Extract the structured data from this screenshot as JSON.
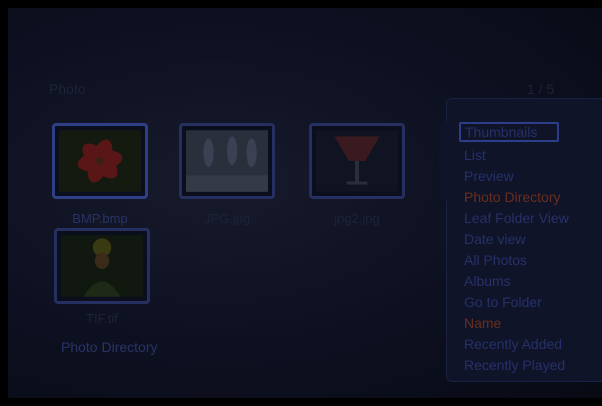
{
  "header": {
    "title": "Photo",
    "page": "1 / 5"
  },
  "grid": {
    "items": [
      {
        "label": "BMP.bmp"
      },
      {
        "label": "JPG.jpg"
      },
      {
        "label": "jpg2.jpg"
      },
      {
        "label": "TIF.tif"
      }
    ]
  },
  "breadcrumb": "Photo Directory",
  "menu": {
    "items": [
      "Thumbnails",
      "List",
      "Preview",
      "Photo Directory",
      "Leaf Folder View",
      "Date view",
      "All Photos",
      "Albums",
      "Go to Folder",
      "Name",
      "Recently Added",
      "Recently Played"
    ],
    "focused_item": "Thumbnails",
    "active_items": [
      "Photo Directory",
      "Name"
    ]
  }
}
